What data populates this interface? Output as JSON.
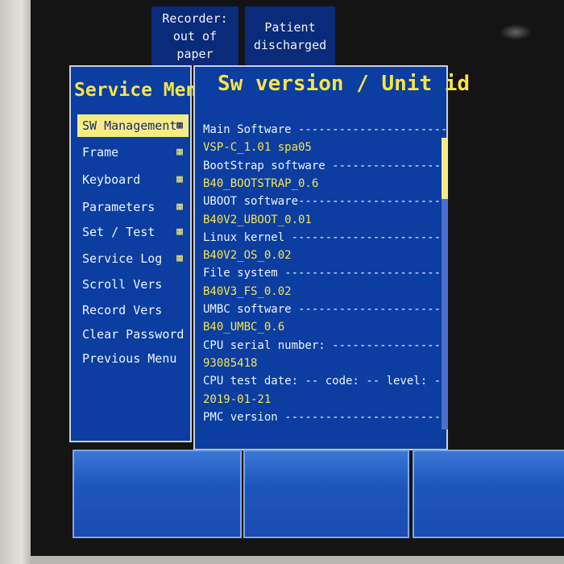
{
  "alarms": {
    "recorder": [
      "Recorder:",
      "out of",
      "paper"
    ],
    "patient": [
      "Patient",
      "discharged"
    ]
  },
  "menu": {
    "title": "Service Menu",
    "items": [
      {
        "label": "SW Management",
        "selected": true,
        "has_submenu": true
      },
      {
        "label": "Frame",
        "selected": false,
        "has_submenu": true
      },
      {
        "label": "Keyboard",
        "selected": false,
        "has_submenu": true
      },
      {
        "label": "Parameters",
        "selected": false,
        "has_submenu": true
      },
      {
        "label": "Set / Test",
        "selected": false,
        "has_submenu": true
      },
      {
        "label": "Service Log",
        "selected": false,
        "has_submenu": true
      },
      {
        "label": "Scroll Vers",
        "selected": false,
        "has_submenu": false
      },
      {
        "label": "Record Vers",
        "selected": false,
        "has_submenu": false
      },
      {
        "label": "Clear Password",
        "selected": false,
        "has_submenu": false
      },
      {
        "label": "Previous Menu",
        "selected": false,
        "has_submenu": false
      }
    ]
  },
  "sw": {
    "title": "Sw version / Unit id",
    "lines": [
      {
        "text": "Main Software ----------------------",
        "kind": "head"
      },
      {
        "text": "VSP-C_1.01 spa05",
        "kind": "val"
      },
      {
        "text": "BootStrap software ----------------",
        "kind": "head"
      },
      {
        "text": "B40_BOOTSTRAP_0.6",
        "kind": "val"
      },
      {
        "text": "UBOOT software----------------------",
        "kind": "head"
      },
      {
        "text": "B40V2_UBOOT_0.01",
        "kind": "val"
      },
      {
        "text": "Linux kernel ----------------------",
        "kind": "head"
      },
      {
        "text": "B40V2_OS_0.02",
        "kind": "val"
      },
      {
        "text": "File system -----------------------",
        "kind": "head"
      },
      {
        "text": "B40V3_FS_0.02",
        "kind": "val"
      },
      {
        "text": "UMBC software ---------------------",
        "kind": "head"
      },
      {
        "text": "B40_UMBC_0.6",
        "kind": "val"
      },
      {
        "text": "CPU serial number: ----------------",
        "kind": "head"
      },
      {
        "text": "93085418",
        "kind": "val"
      },
      {
        "text": "CPU test date: -- code: -- level: --",
        "kind": "head"
      },
      {
        "text": "2019-01-21",
        "kind": "val"
      },
      {
        "text": "PMC version -----------------------",
        "kind": "head"
      }
    ],
    "scroll_fraction": 0.21
  },
  "colors": {
    "panel": "#0b3ea0",
    "highlight": "#f6ec86",
    "title_yellow": "#f5e44a"
  },
  "icons": {
    "submenu": "submenu-icon"
  }
}
